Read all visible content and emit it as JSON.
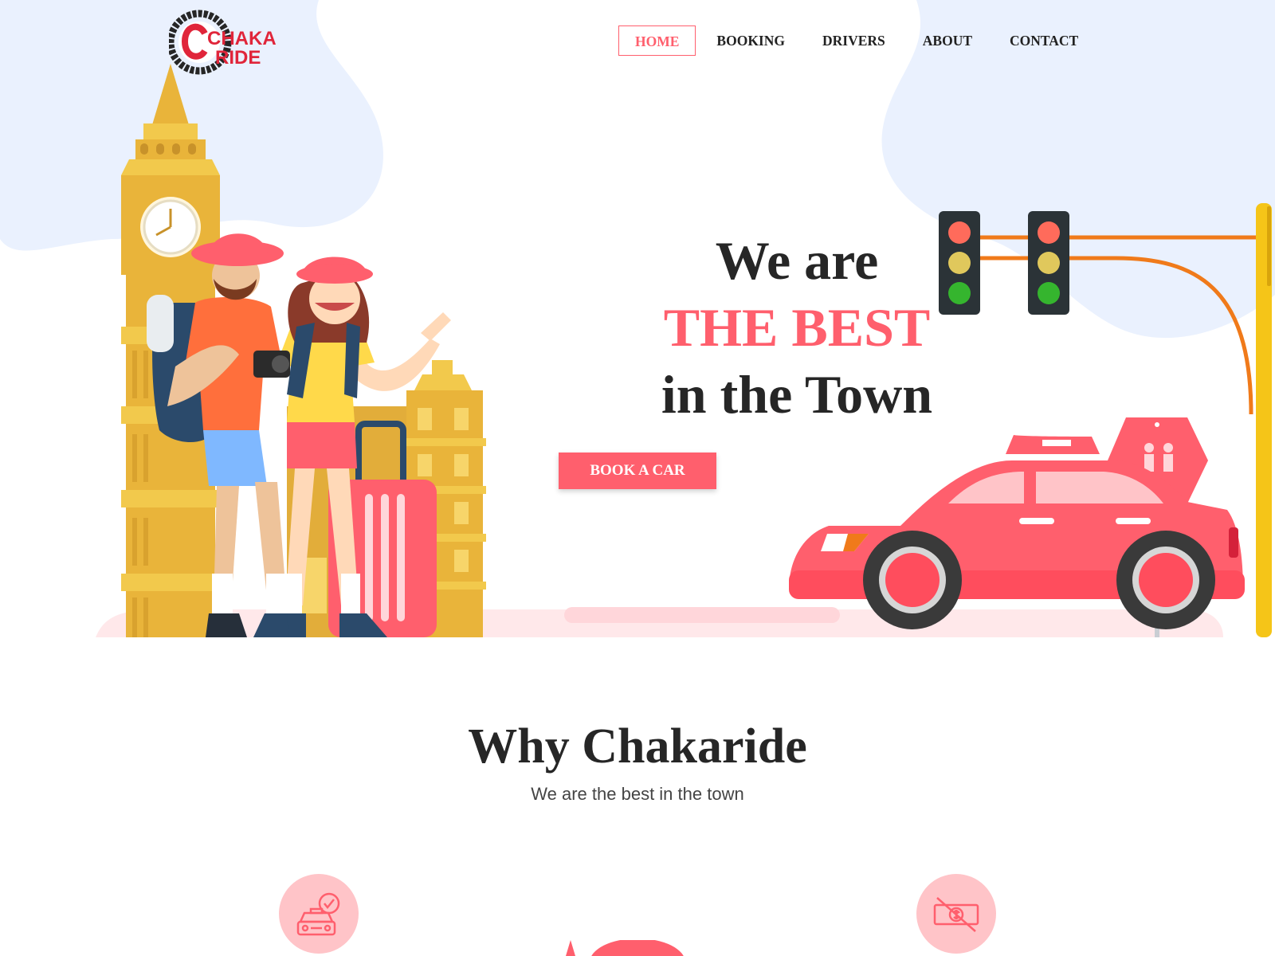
{
  "brand": {
    "logo_line1": "CHAKA",
    "logo_line2": "RIDE",
    "primary_color": "#ff5f6d",
    "dark_text": "#262626"
  },
  "nav": {
    "items": [
      {
        "label": "HOME",
        "active": true
      },
      {
        "label": "BOOKING",
        "active": false
      },
      {
        "label": "DRIVERS",
        "active": false
      },
      {
        "label": "ABOUT",
        "active": false
      },
      {
        "label": "CONTACT",
        "active": false
      }
    ]
  },
  "hero": {
    "line1": "We are",
    "line2": "THE BEST",
    "line3": "in the Town",
    "cta_label": "BOOK A CAR"
  },
  "why": {
    "title": "Why Chakaride",
    "subtitle": "We are the best in the town",
    "features": [
      {
        "icon": "taxi-check-icon"
      },
      {
        "icon": "no-cash-icon"
      }
    ]
  }
}
